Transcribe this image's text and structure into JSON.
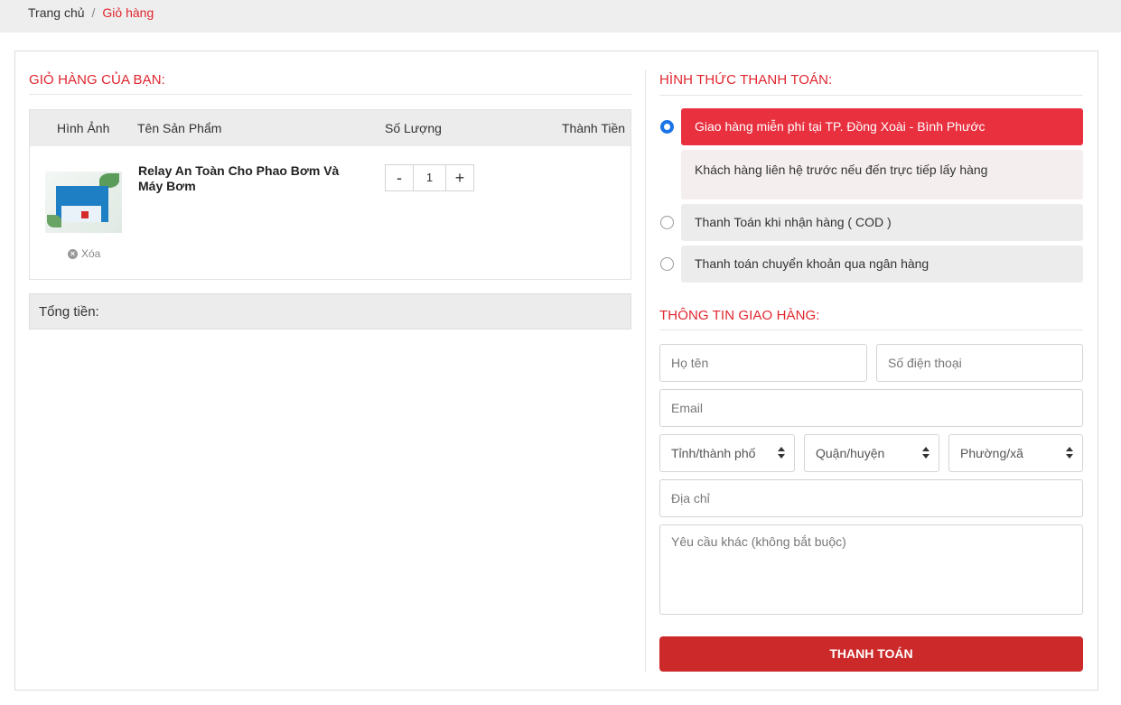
{
  "breadcrumb": {
    "home": "Trang chủ",
    "separator": "/",
    "current": "Giỏ hàng"
  },
  "cart": {
    "title": "GIỎ HÀNG CỦA BẠN:",
    "columns": [
      "Hình Ảnh",
      "Tên Sản Phẩm",
      "Số Lượng",
      "Thành Tiền"
    ],
    "items": [
      {
        "name": "Relay An Toàn Cho Phao Bơm Và Máy Bơm",
        "quantity": "1",
        "delete_label": "Xóa",
        "image_icon": "product-thumbnail"
      }
    ],
    "total_label": "Tổng tiền:",
    "qty_minus": "-",
    "qty_plus": "+"
  },
  "payment": {
    "title": "HÌNH THỨC THANH TOÁN:",
    "options": [
      {
        "label": "Giao hàng miễn phí tại TP. Đồng Xoài - Bình Phước",
        "selected": true,
        "note": "Khách hàng liên hệ trước nếu đến trực tiếp lấy hàng"
      },
      {
        "label": "Thanh Toán khi nhận hàng ( COD )",
        "selected": false
      },
      {
        "label": "Thanh toán chuyển khoản qua ngân hàng",
        "selected": false
      }
    ],
    "accent_color": "#e8303f",
    "radio_color": "#1a73e8"
  },
  "shipping": {
    "title": "THÔNG TIN GIAO HÀNG:",
    "placeholders": {
      "name": "Họ tên",
      "phone": "Số điện thoại",
      "email": "Email",
      "address": "Địa chỉ",
      "notes": "Yêu cầu khác (không bắt buộc)"
    },
    "selects": {
      "province": "Tỉnh/thành phố",
      "district": "Quận/huyện",
      "ward": "Phường/xã"
    },
    "submit_label": "THANH TOÁN",
    "submit_color": "#cc2a2a"
  }
}
